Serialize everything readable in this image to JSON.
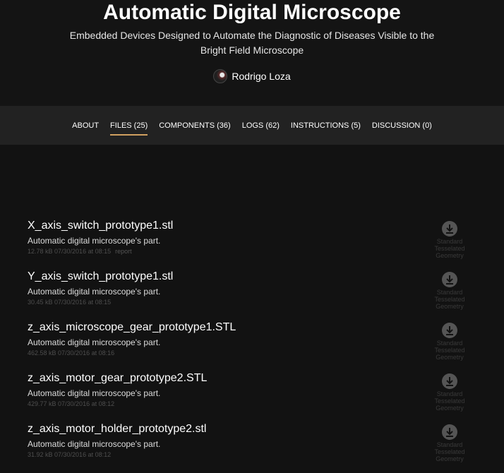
{
  "header": {
    "title": "Automatic Digital Microscope",
    "subtitle": "Embedded Devices Designed to Automate the Diagnostic of Diseases Visible to the Bright Field Microscope",
    "author": "Rodrigo Loza"
  },
  "nav": {
    "items": [
      {
        "label": "ABOUT"
      },
      {
        "label": "FILES (25)"
      },
      {
        "label": "COMPONENTS (36)"
      },
      {
        "label": "LOGS (62)"
      },
      {
        "label": "INSTRUCTIONS (5)"
      },
      {
        "label": "DISCUSSION (0)"
      }
    ],
    "active": "FILES (25)"
  },
  "files": [
    {
      "name": "X_axis_switch_prototype1.stl",
      "description": "Automatic digital microscope's part.",
      "meta": "12.78 kB 07/30/2016 at 08:15",
      "report": "report",
      "format": "Standard Tesselated Geometry"
    },
    {
      "name": "Y_axis_switch_prototype1.stl",
      "description": "Automatic digital microscope's part.",
      "meta": "30.45 kB 07/30/2016 at 08:15",
      "format": "Standard Tesselated Geometry"
    },
    {
      "name": "z_axis_microscope_gear_prototype1.STL",
      "description": "Automatic digital microscope's part.",
      "meta": "462.58 kB 07/30/2016 at 08:16",
      "format": "Standard Tesselated Geometry"
    },
    {
      "name": "z_axis_motor_gear_prototype2.STL",
      "description": "Automatic digital microscope's part.",
      "meta": "429.77 kB 07/30/2016 at 08:12",
      "format": "Standard Tesselated Geometry"
    },
    {
      "name": "z_axis_motor_holder_prototype2.stl",
      "description": "Automatic digital microscope's part.",
      "meta": "31.92 kB 07/30/2016 at 08:12",
      "format": "Standard Tesselated Geometry"
    }
  ],
  "icons": {
    "download": "download-icon"
  },
  "colors": {
    "accent": "#d0a060",
    "background": "#121212",
    "nav_bg": "#222222"
  }
}
